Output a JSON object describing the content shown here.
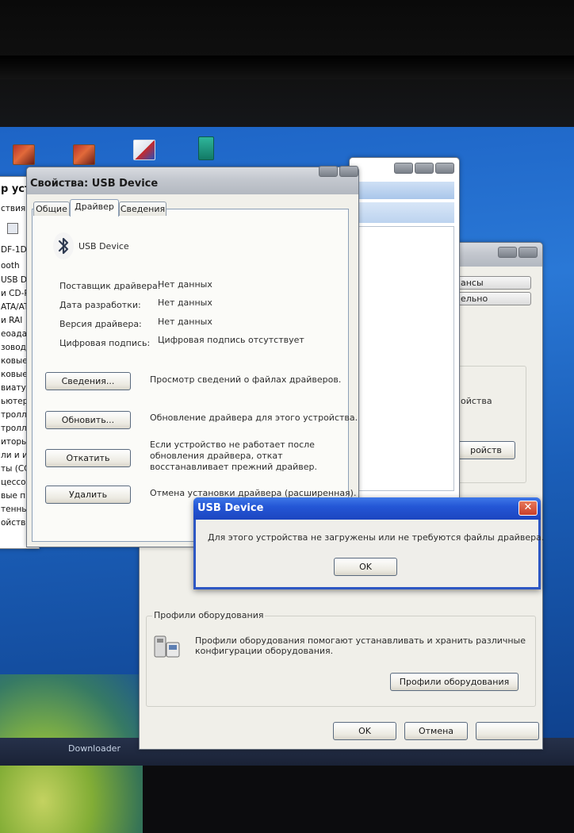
{
  "taskbar": {
    "downloader_label": "Downloader"
  },
  "colors": {
    "xp_blue_title": "#2457d6",
    "close_red": "#c8402a",
    "desktop_blue": "#1d64c6"
  },
  "device_manager_list": {
    "title": "р уст",
    "lines": [
      "ствия",
      "",
      "DF-1D",
      "ooth",
      "USB De",
      "и CD-R",
      "ATA/AT",
      "и RAI",
      "еоадал",
      "зоводь",
      "ковые",
      "ковые,",
      "виатур",
      "ьютер",
      "тролле",
      "тролле",
      "иторы",
      "ли и ин",
      "ты (СС",
      "цессор",
      "вые п",
      "тенные",
      "ойства"
    ]
  },
  "back_window": {
    "side_buttons": [
      "ансы",
      "ельно"
    ],
    "right_text": "ойства",
    "right_button": "ройств",
    "profiles_group_title": "Профили оборудования",
    "profiles_text_line1": "Профили оборудования помогают устанавливать и хранить различные",
    "profiles_text_line2": "конфигурации оборудования.",
    "profiles_button": "Профили оборудования",
    "ok_button": "OK",
    "cancel_button": "Отмена"
  },
  "properties_dialog": {
    "title": "Свойства: USB Device",
    "tabs": [
      {
        "label": "Общие",
        "active": false
      },
      {
        "label": "Драйвер",
        "active": true
      },
      {
        "label": "Сведения",
        "active": false
      }
    ],
    "device_name": "USB Device",
    "fields": [
      {
        "label": "Поставщик драйвера:",
        "value": "Нет данных"
      },
      {
        "label": "Дата разработки:",
        "value": "Нет данных"
      },
      {
        "label": "Версия драйвера:",
        "value": "Нет данных"
      },
      {
        "label": "Цифровая подпись:",
        "value": "Цифровая подпись отсутствует"
      }
    ],
    "actions": [
      {
        "button": "Сведения...",
        "desc": [
          "Просмотр сведений о файлах драйверов."
        ]
      },
      {
        "button": "Обновить...",
        "desc": [
          "Обновление драйвера для этого устройства."
        ]
      },
      {
        "button": "Откатить",
        "desc": [
          "Если устройство не работает после",
          "обновления драйвера, откат",
          "восстанавливает прежний драйвер."
        ]
      },
      {
        "button": "Удалить",
        "desc": [
          "Отмена установки драйвера (расширенная)."
        ]
      }
    ]
  },
  "message_box": {
    "title": "USB Device",
    "message": "Для этого устройства не загружены или не требуются файлы драйвера.",
    "ok_button": "OK",
    "close_glyph": "✕"
  }
}
